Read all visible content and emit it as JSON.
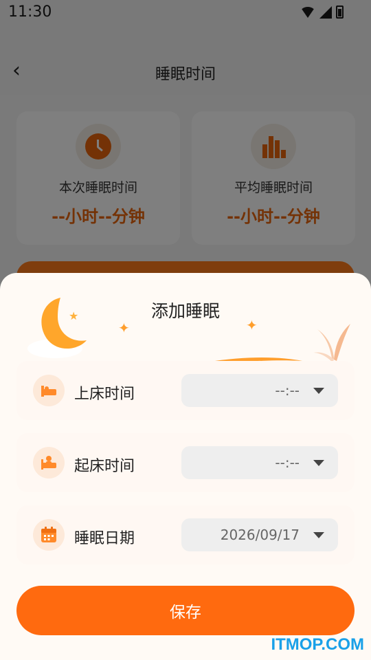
{
  "status_bar": {
    "time": "11:30"
  },
  "header": {
    "title": "睡眠时间",
    "back_icon": "chevron-left-icon"
  },
  "stats": [
    {
      "label": "本次睡眠时间",
      "value": "--小时--分钟",
      "icon": "clock-icon"
    },
    {
      "label": "平均睡眠时间",
      "value": "--小时--分钟",
      "icon": "bar-chart-icon"
    }
  ],
  "dialog": {
    "title": "添加睡眠",
    "rows": [
      {
        "label": "上床时间",
        "value": "--:--",
        "icon": "bed-icon"
      },
      {
        "label": "起床时间",
        "value": "--:--",
        "icon": "wake-up-icon"
      },
      {
        "label": "睡眠日期",
        "value": "2026/09/17",
        "icon": "calendar-icon"
      }
    ],
    "save_label": "保存"
  },
  "watermark": "ITMOP.COM",
  "colors": {
    "accent": "#ff6a0f",
    "accent_text": "#e8650c",
    "sheet_bg": "#fffaf5"
  }
}
